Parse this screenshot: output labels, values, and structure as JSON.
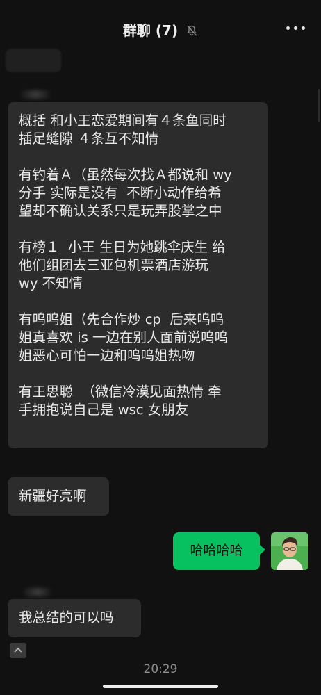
{
  "header": {
    "title": "群聊 (7)",
    "mute_icon": "bell-slash-icon",
    "more_icon": "more-dots-icon"
  },
  "messages": {
    "summary": {
      "paragraphs": [
        "概括 和小王恋爱期间有４条鱼同时\n插足缝隙 ４条互不知情",
        "有钓着Ａ（虽然每次找Ａ都说和 wy\n分手 实际是没有  不断小动作给希\n望却不确认关系只是玩弄股掌之中",
        "有榜１  小王 生日为她跳伞庆生 给\n他们组团去三亚包机票酒店游玩\nwy 不知情",
        "有呜呜姐（先合作炒 cp  后来呜呜\n姐真喜欢 is 一边在别人面前说呜呜\n姐恶心可怕一边和呜呜姐热吻",
        "有王思聪  （微信冷漠见面热情 牵\n手拥抱说自己是 wsc 女朋友"
      ]
    },
    "xinjiang": "新疆好亮啊",
    "hahaha": "哈哈哈哈",
    "summary_ok": "我总结的可以吗"
  },
  "footer": {
    "time": "20:29",
    "collapse_icon": "chevron-up-icon"
  },
  "colors": {
    "background": "#111111",
    "bubble_in": "#2c2c2c",
    "bubble_out": "#07c160",
    "text": "#e9e9e9",
    "time": "#8f8f8f"
  }
}
